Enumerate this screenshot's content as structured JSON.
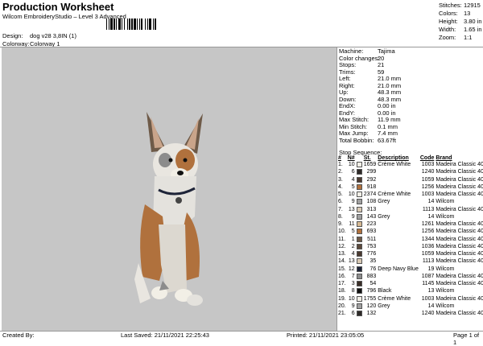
{
  "header": {
    "title": "Production Worksheet",
    "subtitle": "Wilcom EmbroideryStudio – Level 3 Advanced",
    "design_label": "Design:",
    "design_value": "dog v28 3,8IN (1)",
    "colorway_label": "Colorway:",
    "colorway_value": "Colorway 1"
  },
  "stats": [
    {
      "label": "Stitches:",
      "value": "12915"
    },
    {
      "label": "Colors:",
      "value": "13"
    },
    {
      "label": "Height:",
      "value": "3.80 in"
    },
    {
      "label": "Width:",
      "value": "1.65 in"
    },
    {
      "label": "Zoom:",
      "value": "1:1"
    }
  ],
  "machine_info": [
    {
      "label": "Machine:",
      "value": "Tajima"
    },
    {
      "label": "Color changes:",
      "value": "20"
    },
    {
      "label": "Stops:",
      "value": "21"
    },
    {
      "label": "Trims:",
      "value": "59"
    },
    {
      "label": "Left:",
      "value": "21.0 mm"
    },
    {
      "label": "Right:",
      "value": "21.0 mm"
    },
    {
      "label": "Up:",
      "value": "48.3 mm"
    },
    {
      "label": "Down:",
      "value": "48.3 mm"
    },
    {
      "label": "EndX:",
      "value": "0.00 in"
    },
    {
      "label": "EndY:",
      "value": "0.00 in"
    },
    {
      "label": "Max Stitch:",
      "value": "11.9 mm"
    },
    {
      "label": "Min Stitch:",
      "value": "0.1 mm"
    },
    {
      "label": "Max Jump:",
      "value": "7.4 mm"
    },
    {
      "label": "Total Bobbin:",
      "value": "63.67ft"
    }
  ],
  "stop_sequence": {
    "title": "Stop Sequence:",
    "headers": [
      "#",
      "N#",
      "",
      "St.",
      "Description",
      "Code",
      "Brand"
    ],
    "rows": [
      {
        "n": "1.",
        "needle": "10",
        "color": "#f2efe6",
        "st": "1659",
        "desc": "Crème White",
        "code": "1003",
        "brand": "Madeira Classic 40"
      },
      {
        "n": "2.",
        "needle": "6",
        "color": "#2e2a28",
        "st": "299",
        "desc": "",
        "code": "1240",
        "brand": "Madeira Classic 40"
      },
      {
        "n": "3.",
        "needle": "4",
        "color": "#4b3a30",
        "st": "292",
        "desc": "",
        "code": "1059",
        "brand": "Madeira Classic 40"
      },
      {
        "n": "4.",
        "needle": "5",
        "color": "#b0713d",
        "st": "918",
        "desc": "",
        "code": "1256",
        "brand": "Madeira Classic 40"
      },
      {
        "n": "5.",
        "needle": "10",
        "color": "#f2efe6",
        "st": "2374",
        "desc": "Crème White",
        "code": "1003",
        "brand": "Madeira Classic 40"
      },
      {
        "n": "6.",
        "needle": "9",
        "color": "#a0a0a0",
        "st": "108",
        "desc": "Grey",
        "code": "14",
        "brand": "Wilcom"
      },
      {
        "n": "7.",
        "needle": "13",
        "color": "#d8c9b4",
        "st": "313",
        "desc": "",
        "code": "1113",
        "brand": "Madeira Classic 40"
      },
      {
        "n": "8.",
        "needle": "9",
        "color": "#a0a0a0",
        "st": "143",
        "desc": "Grey",
        "code": "14",
        "brand": "Wilcom"
      },
      {
        "n": "9.",
        "needle": "11",
        "color": "#d6b992",
        "st": "223",
        "desc": "",
        "code": "1261",
        "brand": "Madeira Classic 40"
      },
      {
        "n": "10.",
        "needle": "5",
        "color": "#b0713d",
        "st": "693",
        "desc": "",
        "code": "1256",
        "brand": "Madeira Classic 40"
      },
      {
        "n": "11.",
        "needle": "1",
        "color": "#6e5a48",
        "st": "511",
        "desc": "",
        "code": "1344",
        "brand": "Madeira Classic 40"
      },
      {
        "n": "12.",
        "needle": "2",
        "color": "#5c4a3c",
        "st": "753",
        "desc": "",
        "code": "1036",
        "brand": "Madeira Classic 40"
      },
      {
        "n": "13.",
        "needle": "4",
        "color": "#4b3a30",
        "st": "776",
        "desc": "",
        "code": "1059",
        "brand": "Madeira Classic 40"
      },
      {
        "n": "14.",
        "needle": "13",
        "color": "#d8c9b4",
        "st": "35",
        "desc": "",
        "code": "1113",
        "brand": "Madeira Classic 40"
      },
      {
        "n": "15.",
        "needle": "12",
        "color": "#1e2438",
        "st": "76",
        "desc": "Deep Navy Blue",
        "code": "19",
        "brand": "Wilcom"
      },
      {
        "n": "16.",
        "needle": "7",
        "color": "#8c8c8c",
        "st": "883",
        "desc": "",
        "code": "1087",
        "brand": "Madeira Classic 40"
      },
      {
        "n": "17.",
        "needle": "3",
        "color": "#3a2e28",
        "st": "54",
        "desc": "",
        "code": "1145",
        "brand": "Madeira Classic 40"
      },
      {
        "n": "18.",
        "needle": "8",
        "color": "#111111",
        "st": "796",
        "desc": "Black",
        "code": "13",
        "brand": "Wilcom"
      },
      {
        "n": "19.",
        "needle": "10",
        "color": "#f2efe6",
        "st": "1755",
        "desc": "Crème White",
        "code": "1003",
        "brand": "Madeira Classic 40"
      },
      {
        "n": "20.",
        "needle": "9",
        "color": "#a0a0a0",
        "st": "120",
        "desc": "Grey",
        "code": "14",
        "brand": "Wilcom"
      },
      {
        "n": "21.",
        "needle": "6",
        "color": "#2e2a28",
        "st": "132",
        "desc": "",
        "code": "1240",
        "brand": "Madeira Classic 40"
      }
    ]
  },
  "footer": {
    "created_by": "Created By:",
    "last_saved": "Last Saved: 21/11/2021 22:25:43",
    "printed": "Printed: 21/11/2021 23:05:05",
    "page": "Page 1 of 1"
  }
}
